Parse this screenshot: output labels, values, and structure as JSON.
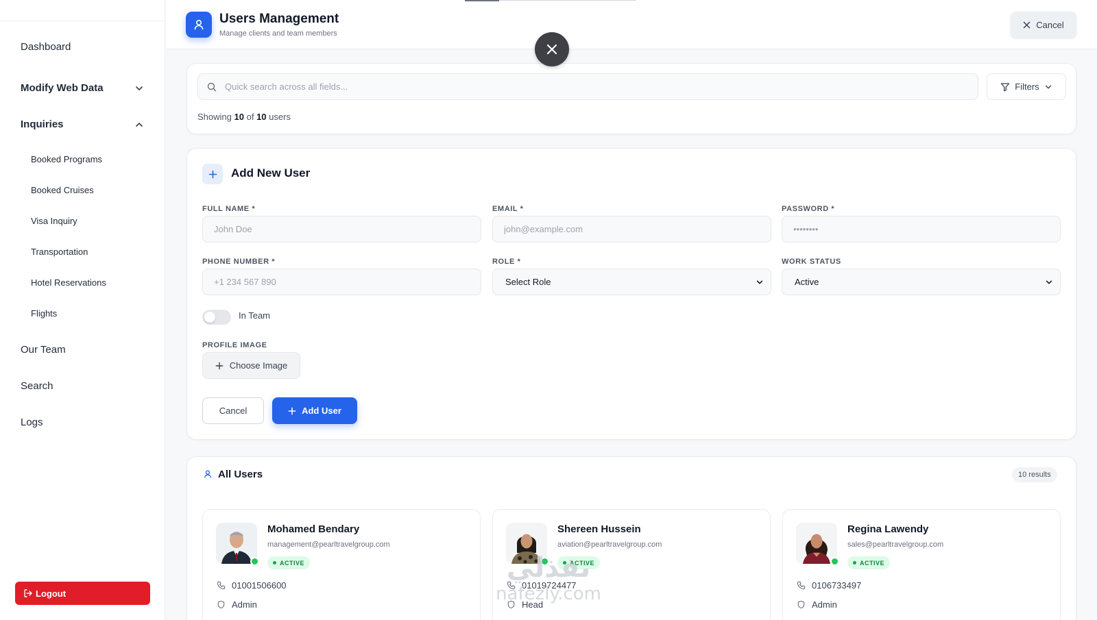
{
  "sidebar": {
    "items": [
      {
        "label": "Dashboard"
      },
      {
        "label": "Modify Web Data"
      },
      {
        "label": "Inquiries"
      },
      {
        "label": "Our Team"
      },
      {
        "label": "Search"
      },
      {
        "label": "Logs"
      }
    ],
    "inquiries_sub": [
      "Booked Programs",
      "Booked Cruises",
      "Visa Inquiry",
      "Transportation",
      "Hotel Reservations",
      "Flights"
    ],
    "logout_label": "Logout"
  },
  "header": {
    "title": "Users Management",
    "subtitle": "Manage clients and team members",
    "cancel_label": "Cancel"
  },
  "search": {
    "placeholder": "Quick search across all fields...",
    "filters_label": "Filters",
    "showing_prefix": "Showing",
    "showing_count": "10",
    "showing_of": "of",
    "showing_total": "10",
    "showing_suffix": "users"
  },
  "add_user": {
    "title": "Add New User",
    "full_name_label": "FULL NAME *",
    "full_name_placeholder": "John Doe",
    "email_label": "EMAIL *",
    "email_placeholder": "john@example.com",
    "password_label": "PASSWORD *",
    "password_placeholder": "••••••••",
    "phone_label": "PHONE NUMBER *",
    "phone_placeholder": "+1 234 567 890",
    "role_label": "ROLE *",
    "role_value": "Select Role",
    "work_status_label": "WORK STATUS",
    "work_status_value": "Active",
    "in_team_label": "In Team",
    "in_team_on": false,
    "profile_image_label": "PROFILE IMAGE",
    "choose_image_label": "Choose Image",
    "cancel_label": "Cancel",
    "add_label": "Add User"
  },
  "all_users": {
    "title": "All Users",
    "results": "10 results",
    "users": [
      {
        "name": "Mohamed Bendary",
        "email": "management@pearltravelgroup.com",
        "status": "ACTIVE",
        "phone": "01001506600",
        "role": "Admin"
      },
      {
        "name": "Shereen Hussein",
        "email": "aviation@pearltravelgroup.com",
        "status": "ACTIVE",
        "phone": "01019724477",
        "role": "Head"
      },
      {
        "name": "Regina Lawendy",
        "email": "sales@pearltravelgroup.com",
        "status": "ACTIVE",
        "phone": "0106733497",
        "role": "Admin"
      }
    ]
  },
  "watermark": {
    "arabic": "نفذلي",
    "latin": "nafezly.com"
  },
  "colors": {
    "primary": "#2563eb",
    "logout": "#e11d2a",
    "active_bg": "#dcfce7",
    "active_text": "#15803d"
  },
  "icons": [
    "user-icon",
    "close-icon",
    "search-icon",
    "filter-icon",
    "chevron-down-icon",
    "chevron-up-icon",
    "plus-icon",
    "phone-icon",
    "shield-icon",
    "logout-icon"
  ]
}
